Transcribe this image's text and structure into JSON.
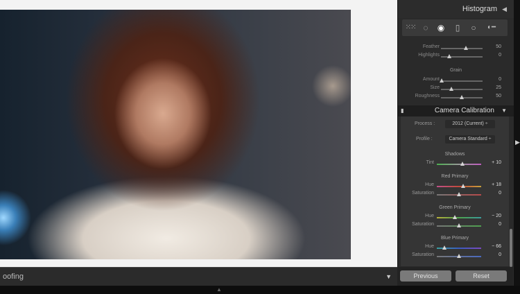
{
  "toolbar": {
    "label": "oofing"
  },
  "panel": {
    "histogram_title": "Histogram",
    "tools": [
      "grid-icon",
      "crop-overlay-icon",
      "spot-removal-icon",
      "red-eye-icon",
      "graduated-filter-icon",
      "adjustment-brush-icon"
    ],
    "effects_rows": [
      {
        "label": "Feather",
        "value": "50",
        "pos": 0.6
      },
      {
        "label": "Highlights",
        "value": "0",
        "pos": 0.2
      }
    ],
    "grain": {
      "title": "Grain",
      "rows": [
        {
          "label": "Amount",
          "value": "0",
          "pos": 0.02
        },
        {
          "label": "Size",
          "value": "25",
          "pos": 0.25
        },
        {
          "label": "Roughness",
          "value": "50",
          "pos": 0.5
        }
      ]
    },
    "calibration": {
      "title": "Camera Calibration",
      "process_label": "Process :",
      "process_value": "2012 (Current) ÷",
      "profile_label": "Profile :",
      "profile_value": "Camera Standard ÷",
      "groups": [
        {
          "title": "Shadows",
          "rows": [
            {
              "label": "Tint",
              "value": "+ 10",
              "pos": 0.58,
              "track": "linear-gradient(90deg,#4caf50,#999,#c05bc0)"
            }
          ]
        },
        {
          "title": "Red Primary",
          "rows": [
            {
              "label": "Hue",
              "value": "+ 18",
              "pos": 0.59,
              "track": "linear-gradient(90deg,#c0508a,#c24a3a,#c9a03a)"
            },
            {
              "label": "Saturation",
              "value": "0",
              "pos": 0.5,
              "track": "linear-gradient(90deg,#777,#b74a4a)"
            }
          ]
        },
        {
          "title": "Green Primary",
          "rows": [
            {
              "label": "Hue",
              "value": "− 20",
              "pos": 0.4,
              "track": "linear-gradient(90deg,#b9b03a,#4da34d,#3a9c9c)"
            },
            {
              "label": "Saturation",
              "value": "0",
              "pos": 0.5,
              "track": "linear-gradient(90deg,#777,#4fa04f)"
            }
          ]
        },
        {
          "title": "Blue Primary",
          "rows": [
            {
              "label": "Hue",
              "value": "− 66",
              "pos": 0.17,
              "track": "linear-gradient(90deg,#3aa0a0,#3a5cc0,#7a4ac0)"
            },
            {
              "label": "Saturation",
              "value": "0",
              "pos": 0.5,
              "track": "linear-gradient(90deg,#777,#4a6ac0)"
            }
          ]
        }
      ]
    },
    "buttons": {
      "previous": "Previous",
      "reset": "Reset"
    }
  }
}
